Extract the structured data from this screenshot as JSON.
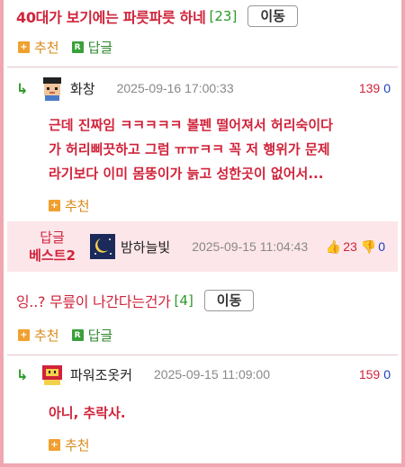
{
  "post1": {
    "title": "40대가 보기에는 파릇파릇 하네",
    "count": "[23]",
    "move_label": "이동",
    "recommend_label": "추천",
    "reply_label": "답글"
  },
  "comment1": {
    "nick": "화창",
    "date": "2025-09-16 17:00:33",
    "up": "139",
    "down": "0",
    "lines": [
      "근데 진짜임 ㅋㅋㅋㅋㅋ 볼펜 떨어져서 허리숙이다",
      "가 허리삐끗하고 그럼 ㅠㅠㅋㅋ 꼭 저 행위가 문제",
      "라기보다 이미 몸뚱이가 늙고 성한곳이 없어서..."
    ],
    "recommend_label": "추천"
  },
  "best": {
    "label_line1": "답글",
    "label_line2": "베스트2",
    "nick": "밤하늘빛",
    "date": "2025-09-15 11:04:43",
    "up": "23",
    "down": "0"
  },
  "post2": {
    "title": "잉..? 무릎이 나간다는건가",
    "count": "[4]",
    "move_label": "이동",
    "recommend_label": "추천",
    "reply_label": "답글"
  },
  "comment2": {
    "nick": "파워조옷커",
    "date": "2025-09-15 11:09:00",
    "up": "159",
    "down": "0",
    "text": "아니, 추락사.",
    "recommend_label": "추천"
  }
}
